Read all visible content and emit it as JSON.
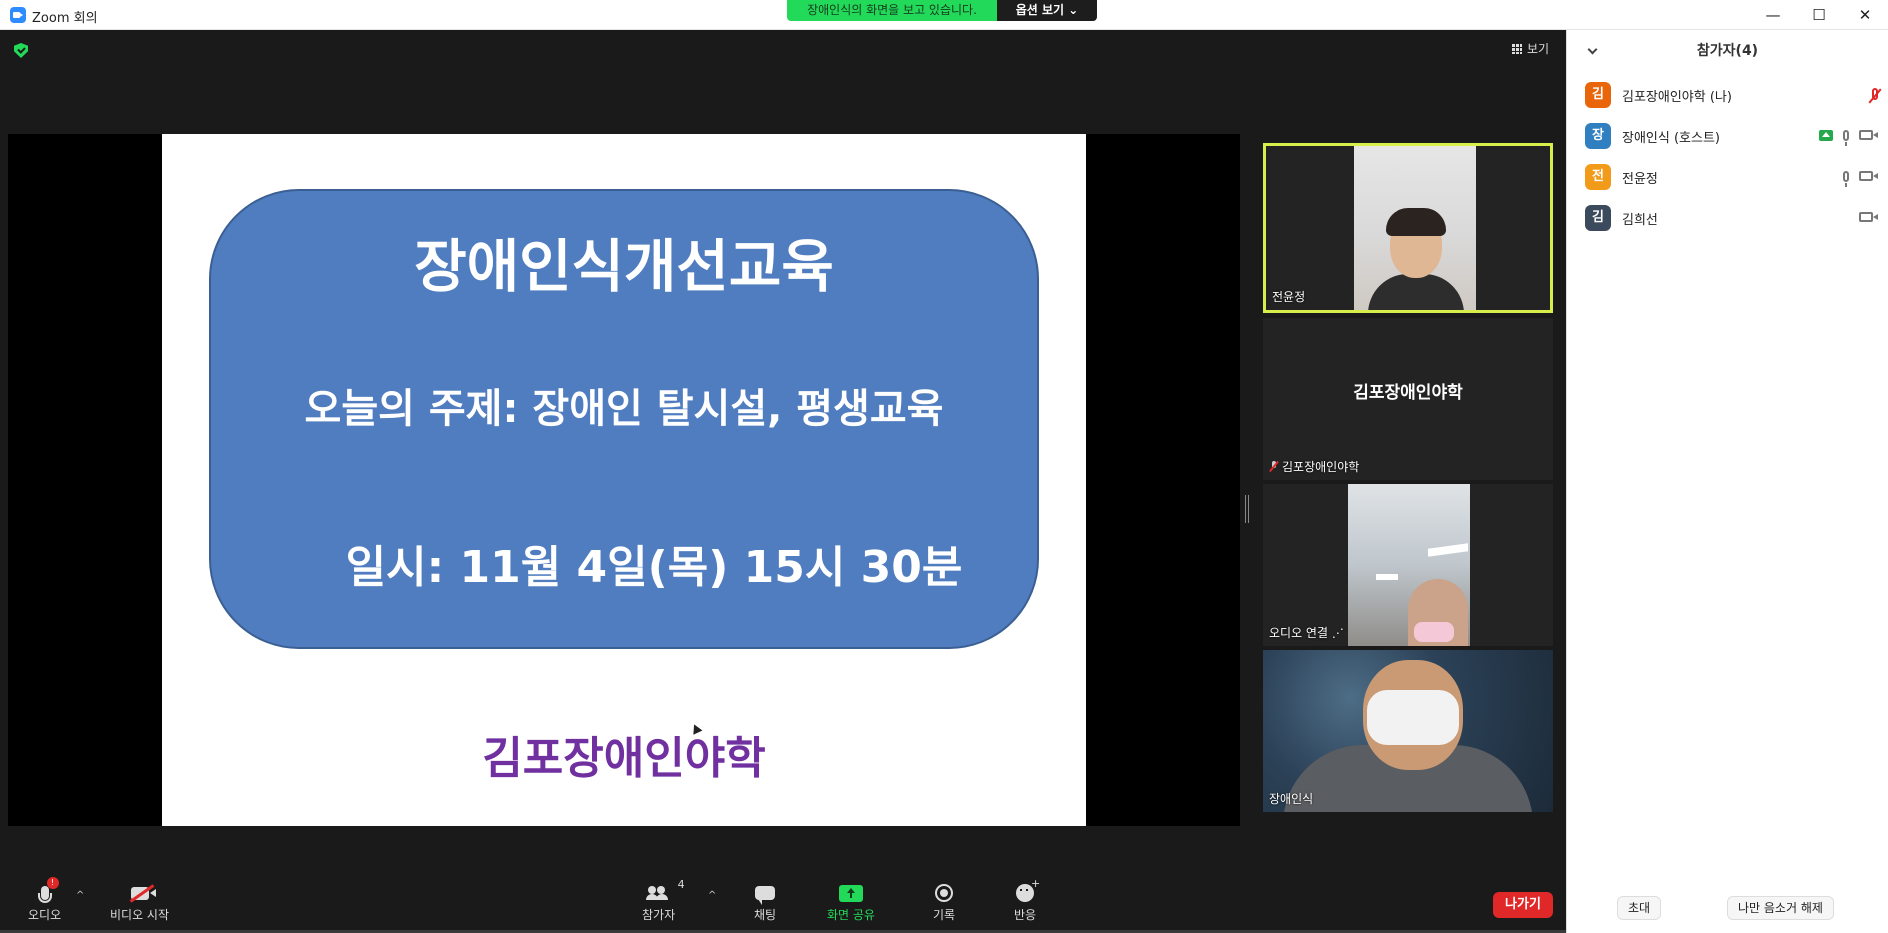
{
  "window": {
    "title": "Zoom 회의",
    "controls": [
      "—",
      "☐",
      "✕"
    ]
  },
  "share_banner": {
    "text": "장애인식의 화면을 보고 있습니다.",
    "options_label": "옵션 보기 ⌄"
  },
  "top_right": {
    "view_label": "보기"
  },
  "slide": {
    "title": "장애인식개선교육",
    "topic": "오늘의 주제: 장애인 탈시설, 평생교육",
    "date": "일시: 11월 4일(목) 15시 30분",
    "org": "김포장애인야학"
  },
  "thumbnails": [
    {
      "name": "전윤정",
      "active": true
    },
    {
      "name": "김포장애인야학",
      "center_name": "김포장애인야학",
      "muted": true
    },
    {
      "name": "오디오 연결 ⋰"
    },
    {
      "name": "장애인식"
    }
  ],
  "toolbar": {
    "audio_label": "오디오",
    "audio_badge": "!",
    "video_label": "비디오 시작",
    "participants_label": "참가자",
    "participants_count": "4",
    "chat_label": "채팅",
    "share_label": "화면 공유",
    "record_label": "기록",
    "reactions_label": "반응",
    "leave_label": "나가기",
    "caret": "^"
  },
  "panel": {
    "header": "참가자(4)",
    "participants": [
      {
        "initial": "김",
        "name": "김포장애인야학 (나)",
        "color": "#e8650a",
        "mic": "muted",
        "video": false,
        "sharing": false
      },
      {
        "initial": "장",
        "name": "장애인식 (호스트)",
        "color": "#2f7fc1",
        "mic": "on",
        "video": true,
        "sharing": true
      },
      {
        "initial": "전",
        "name": "전윤정",
        "color": "#f29a1a",
        "mic": "on",
        "video": true,
        "sharing": false
      },
      {
        "initial": "김",
        "name": "김희선",
        "color": "#3b4a5c",
        "mic": "none",
        "video": true,
        "sharing": false
      }
    ],
    "invite_label": "초대",
    "unmute_label": "나만 음소거 해제"
  }
}
